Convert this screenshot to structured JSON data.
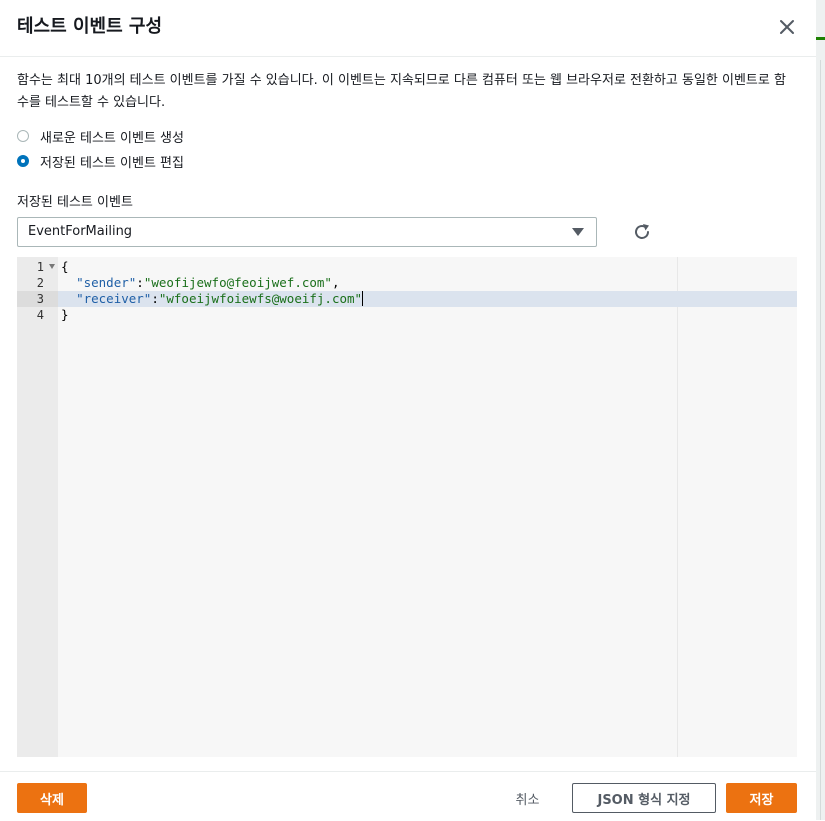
{
  "dialog": {
    "title": "테스트 이벤트 구성",
    "description": "함수는 최대 10개의 테스트 이벤트를 가질 수 있습니다. 이 이벤트는 지속되므로 다른 컴퓨터 또는 웹 브라우저로 전환하고 동일한 이벤트로 함수를 테스트할 수 있습니다."
  },
  "options": {
    "create_new": {
      "label": "새로운 테스트 이벤트 생성",
      "selected": false
    },
    "edit_saved": {
      "label": "저장된 테스트 이벤트 편집",
      "selected": true
    }
  },
  "saved_events": {
    "label": "저장된 테스트 이벤트",
    "selected": "EventForMailing"
  },
  "editor": {
    "line_numbers": [
      "1",
      "2",
      "3",
      "4"
    ],
    "open_brace": "{",
    "close_brace": "}",
    "key1": "\"sender\"",
    "val1": "\"weofijewfo@feoijwef.com\"",
    "key2": "\"receiver\"",
    "val2": "\"wfoeijwfoiewfs@woeifj.com\"",
    "colon": ":",
    "comma": ","
  },
  "footer": {
    "delete_label": "삭제",
    "cancel_label": "취소",
    "format_json_label": "JSON 형식 지정",
    "save_label": "저장"
  },
  "colors": {
    "primary": "#ec7211",
    "radio_selected": "#0073bb",
    "active_line": "#dbe3ee"
  },
  "icons": {
    "close": "close-icon",
    "caret": "caret-down-icon",
    "refresh": "refresh-icon",
    "fold": "fold-arrow-icon"
  }
}
